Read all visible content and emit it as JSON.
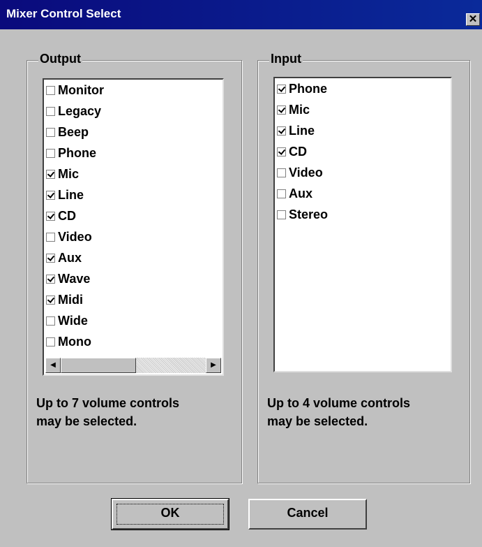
{
  "window": {
    "title": "Mixer Control Select",
    "close_glyph": "✕"
  },
  "output": {
    "legend": "Output",
    "items": [
      {
        "label": "Monitor",
        "checked": false
      },
      {
        "label": "Legacy",
        "checked": false
      },
      {
        "label": "Beep",
        "checked": false
      },
      {
        "label": "Phone",
        "checked": false
      },
      {
        "label": "Mic",
        "checked": true
      },
      {
        "label": "Line",
        "checked": true
      },
      {
        "label": "CD",
        "checked": true
      },
      {
        "label": "Video",
        "checked": false
      },
      {
        "label": "Aux",
        "checked": true
      },
      {
        "label": "Wave",
        "checked": true
      },
      {
        "label": "Midi",
        "checked": true
      },
      {
        "label": "Wide",
        "checked": false
      },
      {
        "label": "Mono",
        "checked": false
      }
    ],
    "note_line1": "Up to 7 volume controls",
    "note_line2": "may be selected."
  },
  "input": {
    "legend": "Input",
    "items": [
      {
        "label": "Phone",
        "checked": true
      },
      {
        "label": "Mic",
        "checked": true
      },
      {
        "label": "Line",
        "checked": true
      },
      {
        "label": "CD",
        "checked": true
      },
      {
        "label": "Video",
        "checked": false
      },
      {
        "label": "Aux",
        "checked": false
      },
      {
        "label": "Stereo",
        "checked": false
      }
    ],
    "note_line1": "Up to 4 volume controls",
    "note_line2": "may be selected."
  },
  "scroll": {
    "left_arrow": "◀",
    "right_arrow": "▶"
  },
  "buttons": {
    "ok": "OK",
    "cancel": "Cancel"
  }
}
